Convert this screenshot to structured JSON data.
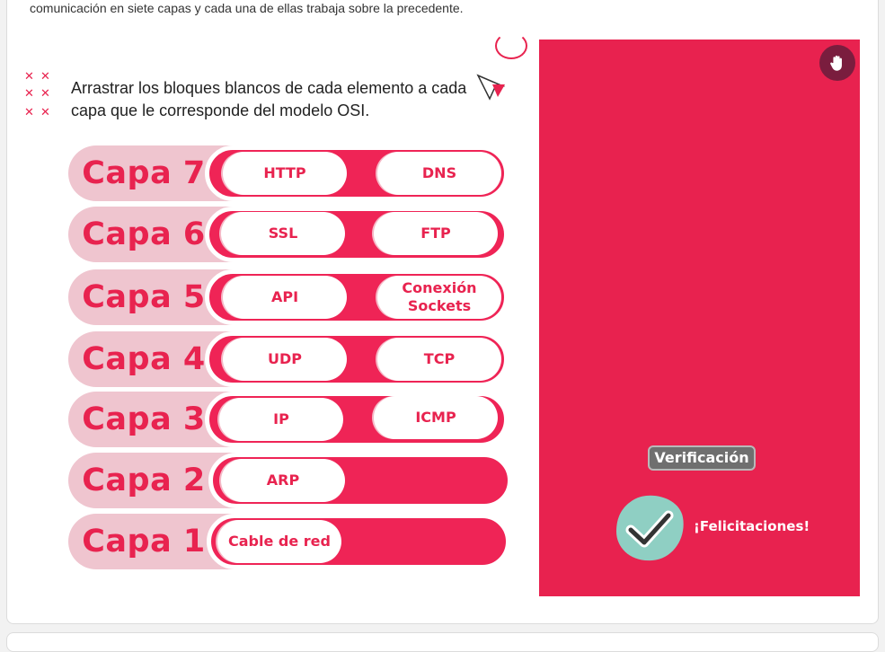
{
  "intro_text": "comunicación en siete capas y cada una de ellas trabaja sobre la precedente.",
  "instruction": "Arrastrar los bloques blancos de cada elemento a cada capa que le corresponde del modelo OSI.",
  "layers": [
    {
      "label": "Capa 7",
      "items": [
        "HTTP",
        "DNS"
      ]
    },
    {
      "label": "Capa 6",
      "items": [
        "SSL",
        "FTP"
      ]
    },
    {
      "label": "Capa 5",
      "items": [
        "API",
        "Conexión Sockets"
      ]
    },
    {
      "label": "Capa 4",
      "items": [
        "UDP",
        "TCP"
      ]
    },
    {
      "label": "Capa 3",
      "items": [
        "IP",
        "ICMP"
      ]
    },
    {
      "label": "Capa 2",
      "items": [
        "ARP"
      ]
    },
    {
      "label": "Capa 1",
      "items": [
        "Cable de red"
      ]
    }
  ],
  "panel": {
    "verify_label": "Verificación",
    "feedback": "¡Felicitaciones!"
  },
  "icons": {
    "decor": "x-pattern-icon",
    "cursor": "cursor-icon",
    "hand": "hand-icon",
    "check": "checkmark-icon"
  },
  "colors": {
    "accent": "#e8234f",
    "label_bg": "#efc5cf",
    "panel": "#e8224f",
    "hand_button": "#7a1d3e",
    "check_blob": "#8fcfc3"
  }
}
